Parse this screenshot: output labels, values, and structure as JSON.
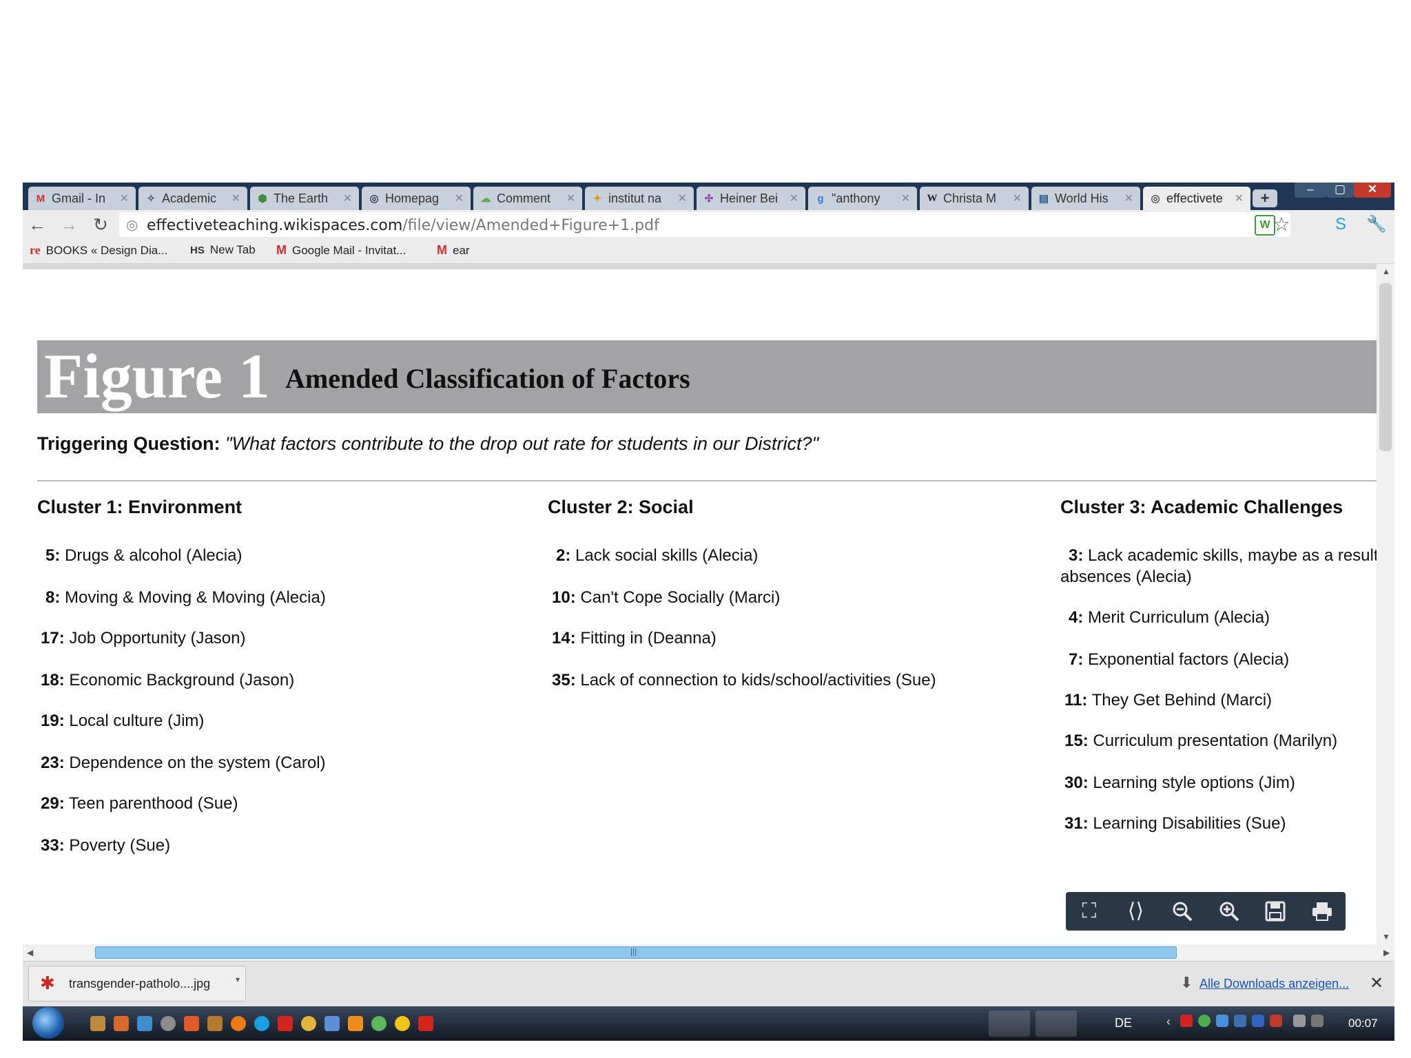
{
  "tabs": [
    {
      "title": "Gmail - In",
      "icon": "M",
      "icon_color": "#d32f2f",
      "active": false
    },
    {
      "title": "Academic",
      "icon": "✧",
      "icon_color": "#555555",
      "active": false
    },
    {
      "title": "The Earth",
      "icon": "⬢",
      "icon_color": "#3c8d3c",
      "active": false
    },
    {
      "title": "Homepag",
      "icon": "◎",
      "icon_color": "#444444",
      "active": false
    },
    {
      "title": "Comment",
      "icon": "☁",
      "icon_color": "#6aa84f",
      "active": false
    },
    {
      "title": "institut na",
      "icon": "✦",
      "icon_color": "#e09b1d",
      "active": false
    },
    {
      "title": "Heiner Bei",
      "icon": "✣",
      "icon_color": "#8e44ad",
      "active": false
    },
    {
      "title": "\"anthony",
      "icon": "g",
      "icon_color": "#2a7ae2",
      "active": false
    },
    {
      "title": "Christa M",
      "icon": "W",
      "icon_color": "#222222",
      "active": false
    },
    {
      "title": "World His",
      "icon": "▤",
      "icon_color": "#2a5b8a",
      "active": false
    },
    {
      "title": "effectivete",
      "icon": "◎",
      "icon_color": "#555555",
      "active": true
    }
  ],
  "window_controls": {
    "minimize": "–",
    "maximize": "▢",
    "close": "✕"
  },
  "newtab_label": "+",
  "address": {
    "host": "effectiveteaching.wikispaces.com",
    "path": "/file/view/Amended+Figure+1.pdf"
  },
  "bookmarks": [
    {
      "label": "BOOKS « Design Dia...",
      "icon": "re",
      "icon_color": "#c0392b"
    },
    {
      "label": "New Tab",
      "icon": "HS",
      "icon_color": "#333333"
    },
    {
      "label": "Google Mail - Invitat...",
      "icon": "M",
      "icon_color": "#d32f2f"
    },
    {
      "label": "ear",
      "icon": "M",
      "icon_color": "#d32f2f"
    }
  ],
  "document": {
    "figure_label": "Figure 1",
    "figure_title": "Amended Classification of Factors",
    "trigger_label": "Triggering Question:",
    "trigger_question": "\"What factors contribute to the drop out rate for students in our District?\"",
    "clusters": [
      {
        "heading": "Cluster 1: Environment",
        "items": [
          {
            "num": "5:",
            "text": "Drugs & alcohol (Alecia)"
          },
          {
            "num": "8:",
            "text": "Moving & Moving & Moving (Alecia)"
          },
          {
            "num": "17:",
            "text": "Job Opportunity (Jason)"
          },
          {
            "num": "18:",
            "text": "Economic Background (Jason)"
          },
          {
            "num": "19:",
            "text": "Local culture (Jim)"
          },
          {
            "num": "23:",
            "text": "Dependence on the system (Carol)"
          },
          {
            "num": "29:",
            "text": "Teen parenthood (Sue)"
          },
          {
            "num": "33:",
            "text": "Poverty (Sue)"
          }
        ]
      },
      {
        "heading": "Cluster 2: Social",
        "items": [
          {
            "num": "2:",
            "text": "Lack social skills (Alecia)"
          },
          {
            "num": "10:",
            "text": "Can't Cope Socially (Marci)"
          },
          {
            "num": "14:",
            "text": "Fitting in (Deanna)"
          },
          {
            "num": "35:",
            "text": "Lack of connection to kids/school/activities (Sue)"
          }
        ]
      },
      {
        "heading": "Cluster 3: Academic Challenges",
        "items": [
          {
            "num": "3:",
            "text": "Lack academic skills, maybe as a result of a",
            "text2": "absences (Alecia)"
          },
          {
            "num": "4:",
            "text": "Merit Curriculum (Alecia)"
          },
          {
            "num": "7:",
            "text": "Exponential factors (Alecia)"
          },
          {
            "num": "11:",
            "text": "They Get Behind (Marci)"
          },
          {
            "num": "15:",
            "text": "Curriculum presentation (Marilyn)"
          },
          {
            "num": "30:",
            "text": "Learning style options (Jim)"
          },
          {
            "num": "31:",
            "text": "Learning Disabilities (Sue)"
          }
        ]
      }
    ]
  },
  "pdf_controls": [
    "fit-page",
    "fit-width",
    "zoom-out",
    "zoom-in",
    "save",
    "print"
  ],
  "download": {
    "filename": "transgender-patholo....jpg",
    "show_all": "Alle Downloads anzeigen..."
  },
  "taskbar": {
    "language": "DE",
    "time": "00:07"
  }
}
